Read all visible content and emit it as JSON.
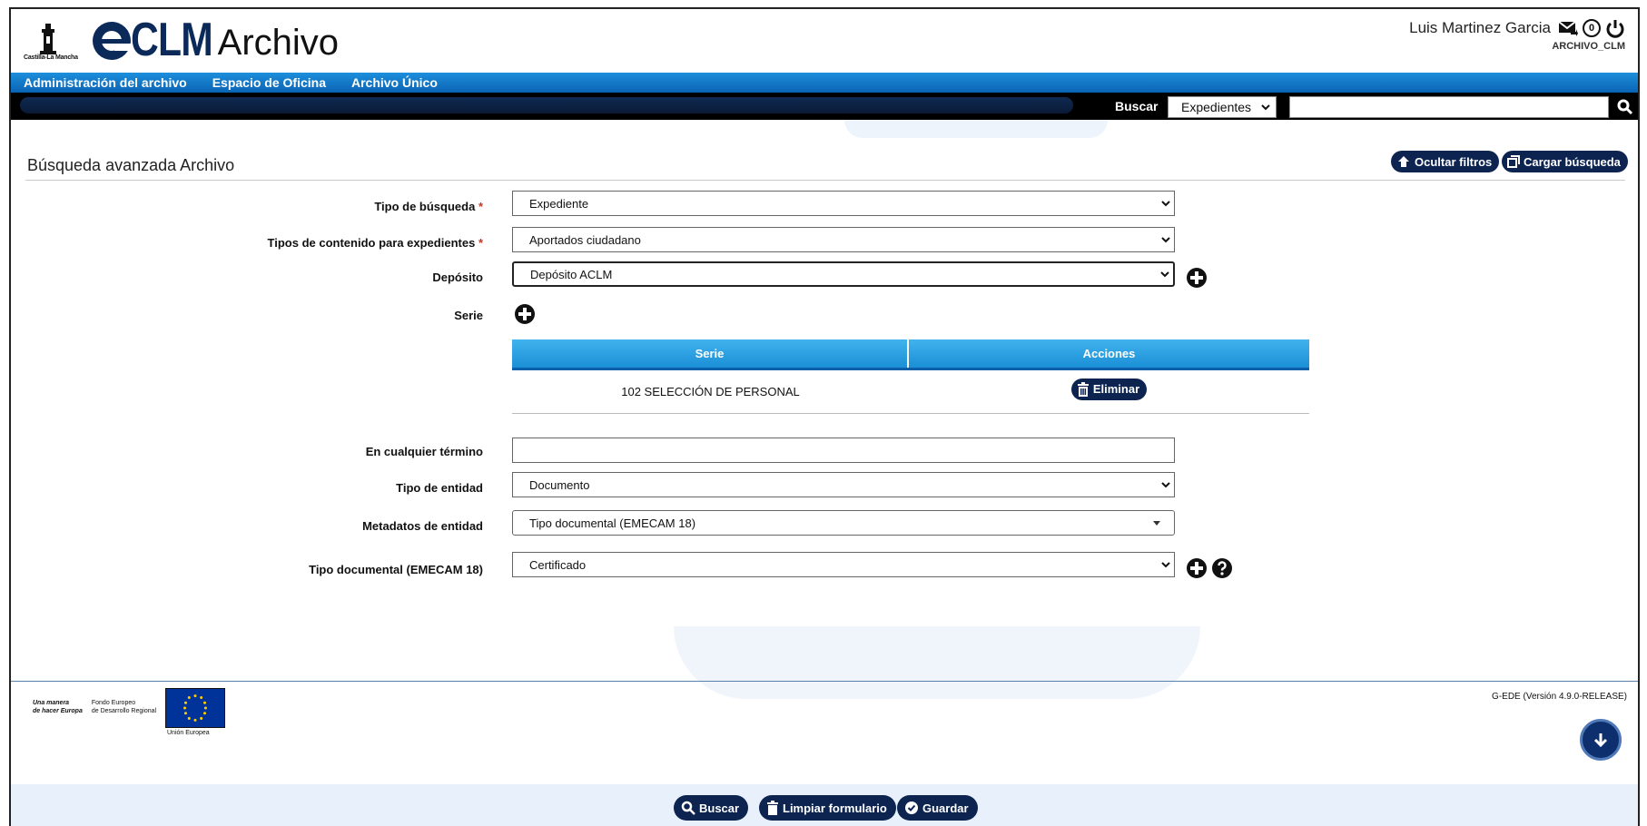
{
  "header": {
    "jccm_caption": "Castilla-La Mancha",
    "brand_e": "e",
    "brand_clm": "CLM",
    "brand_archivo": "Archivo",
    "user_name": "Luis Martinez Garcia",
    "notifications_count": "0",
    "user_role": "ARCHIVO_CLM"
  },
  "nav": {
    "items": [
      {
        "label": "Administración del archivo"
      },
      {
        "label": "Espacio de Oficina"
      },
      {
        "label": "Archivo Único"
      }
    ]
  },
  "search": {
    "label": "Buscar",
    "scope_value": "Expedientes",
    "query_value": ""
  },
  "page": {
    "title": "Búsqueda avanzada Archivo",
    "hide_filters_label": "Ocultar filtros",
    "load_search_label": "Cargar búsqueda"
  },
  "form": {
    "tipo_busqueda": {
      "label": "Tipo de búsqueda",
      "required_mark": "*",
      "value": "Expediente"
    },
    "tipos_contenido": {
      "label": "Tipos de contenido para expedientes",
      "required_mark": "*",
      "value": "Aportados ciudadano"
    },
    "deposito": {
      "label": "Depósito",
      "value": "Depósito ACLM"
    },
    "serie": {
      "label": "Serie"
    },
    "series_table": {
      "headers": [
        "Serie",
        "Acciones"
      ],
      "rows": [
        {
          "serie": "102 SELECCIÓN DE PERSONAL",
          "action_label": "Eliminar"
        }
      ]
    },
    "cualquier_termino": {
      "label": "En cualquier término",
      "value": ""
    },
    "tipo_entidad": {
      "label": "Tipo de entidad",
      "value": "Documento"
    },
    "metadatos_entidad": {
      "label": "Metadatos de entidad",
      "value": "Tipo documental (EMECAM 18)"
    },
    "tipo_documental": {
      "label": "Tipo documental (EMECAM 18)",
      "value": "Certificado"
    }
  },
  "footer": {
    "eu_motto_1": "Una manera",
    "eu_motto_2": "de hacer Europa",
    "eu_fund_1": "Fondo Europeo",
    "eu_fund_2": "de Desarrollo Regional",
    "eu_caption": "Unión Europea",
    "version": "G-EDE (Versión 4.9.0-RELEASE)"
  },
  "actions": {
    "search_label": "Buscar",
    "clear_label": "Limpiar formulario",
    "save_label": "Guardar"
  },
  "colors": {
    "accent_dark": "#0d2450",
    "nav_blue": "#0a63b3",
    "table_header": "#1b8fd6",
    "required": "#c0392b"
  }
}
